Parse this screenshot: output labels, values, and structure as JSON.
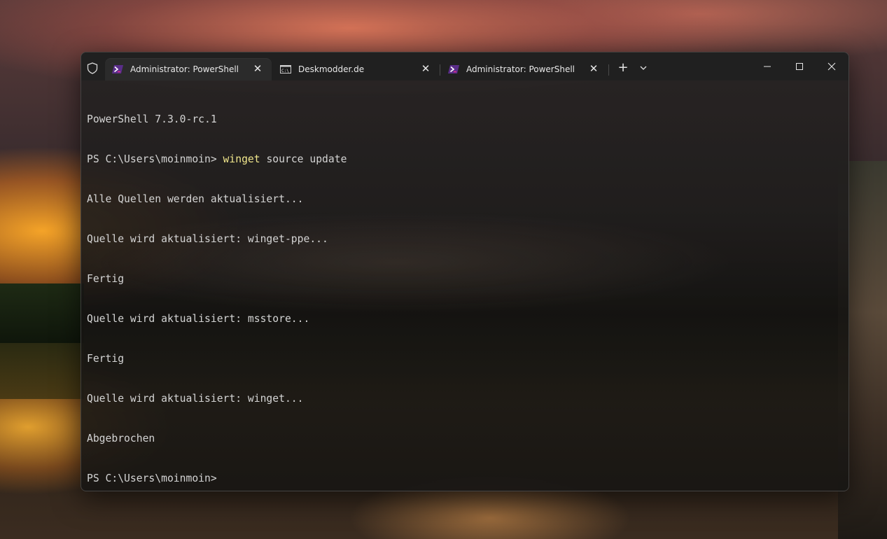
{
  "tabs": [
    {
      "title": "Administrator: PowerShell",
      "icon": "powershell-icon",
      "active": true
    },
    {
      "title": "Deskmodder.de",
      "icon": "cmd-icon",
      "active": false
    },
    {
      "title": "Administrator: PowerShell",
      "icon": "powershell-icon",
      "active": false
    }
  ],
  "controls": {
    "new_tab": "+",
    "close_glyph": "✕"
  },
  "console": {
    "line1": "PowerShell 7.3.0-rc.1",
    "line2_prompt": "PS C:\\Users\\moinmoin> ",
    "line2_cmd": "winget",
    "line2_args": " source update",
    "line3": "Alle Quellen werden aktualisiert...",
    "line4": "Quelle wird aktualisiert: winget-ppe...",
    "line5": "Fertig",
    "line6": "Quelle wird aktualisiert: msstore...",
    "line7": "Fertig",
    "line8": "Quelle wird aktualisiert: winget...",
    "line9": "Abgebrochen",
    "line10": "PS C:\\Users\\moinmoin>"
  },
  "colors": {
    "command_highlight": "#f0e68c",
    "text": "#d4d4d4",
    "titlebar": "#202020",
    "powershell_accent": "#c41e7a"
  }
}
